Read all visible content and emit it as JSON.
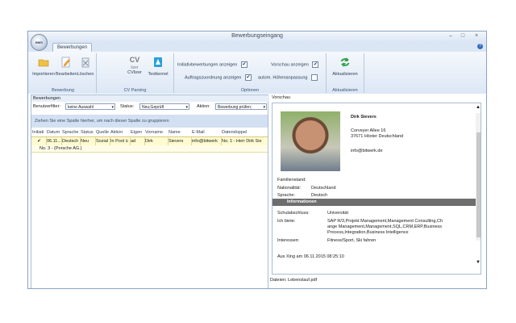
{
  "window": {
    "title": "Bewerbungseingang",
    "app_logo_text": "BMS"
  },
  "ribbon": {
    "tab": "Bewerbungen",
    "groups": {
      "bewerbung": {
        "label": "Bewerbung",
        "buttons": [
          "Importieren",
          "Bearbeiten",
          "Löschen"
        ]
      },
      "cvparsing": {
        "label": "CV Parsing",
        "buttons": [
          "CVlizer",
          "Textkernel"
        ],
        "cvlizer_logo": "CV",
        "cvlizer_sub": "lizer"
      },
      "optionen": {
        "label": "Optionen",
        "options": [
          {
            "label": "Initiativbewerbungen anzeigen",
            "checked": true
          },
          {
            "label": "Auftragszuordnung anzeigen",
            "checked": true
          },
          {
            "label": "Vorschau anzeigen",
            "checked": true
          },
          {
            "label": "autom. Höhenanpassung",
            "checked": false
          }
        ]
      },
      "aktualisieren": {
        "label": "Aktualisieren",
        "button": "Aktualisieren"
      }
    }
  },
  "left_panel": {
    "title": "Bewerbungen",
    "filters": {
      "benutzerfilter_label": "Benutzerfilter:",
      "benutzerfilter_value": "keine Auswahl",
      "status_label": "Status:",
      "status_value": "Neu;Geprüft",
      "aktion_label": "Aktion:",
      "aktion_value": "Bewerbung prüfen;"
    },
    "group_hint": "Ziehen Sie eine Spalte hierher, um nach dieser Spalte zu gruppieren",
    "columns": [
      "Initiati",
      "Datum",
      "Sprache",
      "Status",
      "Quelle",
      "Aktion",
      "Eigen",
      "Vorname",
      "Name",
      "E-Mail",
      "Datendoppel"
    ],
    "rows": [
      {
        "cells": [
          "✔",
          "06.11...",
          "Deutsch",
          "Neu",
          "Sozial",
          "In Pool ü",
          "ad",
          "Dirk",
          "Sievers",
          "info@bitwerk",
          "No. 1 - Herr Dirk Sie"
        ]
      }
    ],
    "group_row": "No. 3 - (Porsche AG.)"
  },
  "preview": {
    "title": "Vorschau",
    "name": "Dirk Sievers",
    "address1": "Corveyer Allee 16",
    "address2": "37671 Höxter Deutschland",
    "email": "info@bitwerk.de",
    "personal": [
      {
        "label": "Familienstand:",
        "value": ""
      },
      {
        "label": "Nationalität:",
        "value": "Deutschland"
      },
      {
        "label": "Sprache:",
        "value": "Deutsch"
      }
    ],
    "info_header": "Informationen",
    "info": [
      {
        "label": "Schulabschluss:",
        "value": "Universität"
      },
      {
        "label": "Ich biete:",
        "value": "SAP R/3,Projekt Management,Management Consulting,Change Management,Management,SQL,CRM,ERP,Business Process,Integration,Business Intelligence"
      },
      {
        "label": "Interessen:",
        "value": "Fitness/Sport, Ski fahren"
      }
    ],
    "source_line": "Aus Xing am 06.11.2015 08:25:10"
  },
  "status": {
    "files": "Dateien: Lebenslauf.pdf"
  },
  "colors": {
    "accent": "#3a6bc4",
    "selected_row": "#fffbd0",
    "info_header": "#6e6e6e"
  }
}
